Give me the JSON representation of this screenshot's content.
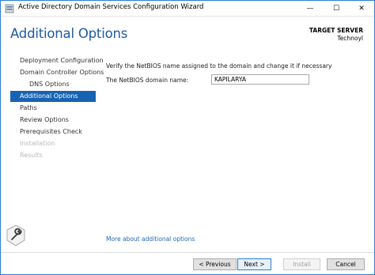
{
  "window": {
    "title": "Active Directory Domain Services Configuration Wizard",
    "minimize_glyph": "—",
    "maximize_glyph": "☐",
    "close_glyph": "✕"
  },
  "header": {
    "title": "Additional Options",
    "target_label": "TARGET SERVER",
    "target_name": "Technoyl"
  },
  "nav": {
    "items": [
      {
        "label": "Deployment Configuration",
        "state": "normal"
      },
      {
        "label": "Domain Controller Options",
        "state": "normal"
      },
      {
        "label": "DNS Options",
        "state": "sub"
      },
      {
        "label": "Additional Options",
        "state": "active"
      },
      {
        "label": "Paths",
        "state": "normal"
      },
      {
        "label": "Review Options",
        "state": "normal"
      },
      {
        "label": "Prerequisites Check",
        "state": "normal"
      },
      {
        "label": "Installation",
        "state": "disabled"
      },
      {
        "label": "Results",
        "state": "disabled"
      }
    ]
  },
  "main": {
    "instructions": "Verify the NetBIOS name assigned to the domain and change it if necessary",
    "netbios_label": "The NetBIOS domain name:",
    "netbios_value": "KAPILARYA",
    "more_link": "More about additional options"
  },
  "footer": {
    "previous_label": "< Previous",
    "next_label": "Next >",
    "install_label": "Install",
    "cancel_label": "Cancel"
  },
  "colors": {
    "accent": "#1763b3",
    "title_blue": "#1e5aa0",
    "link": "#2166b5"
  }
}
